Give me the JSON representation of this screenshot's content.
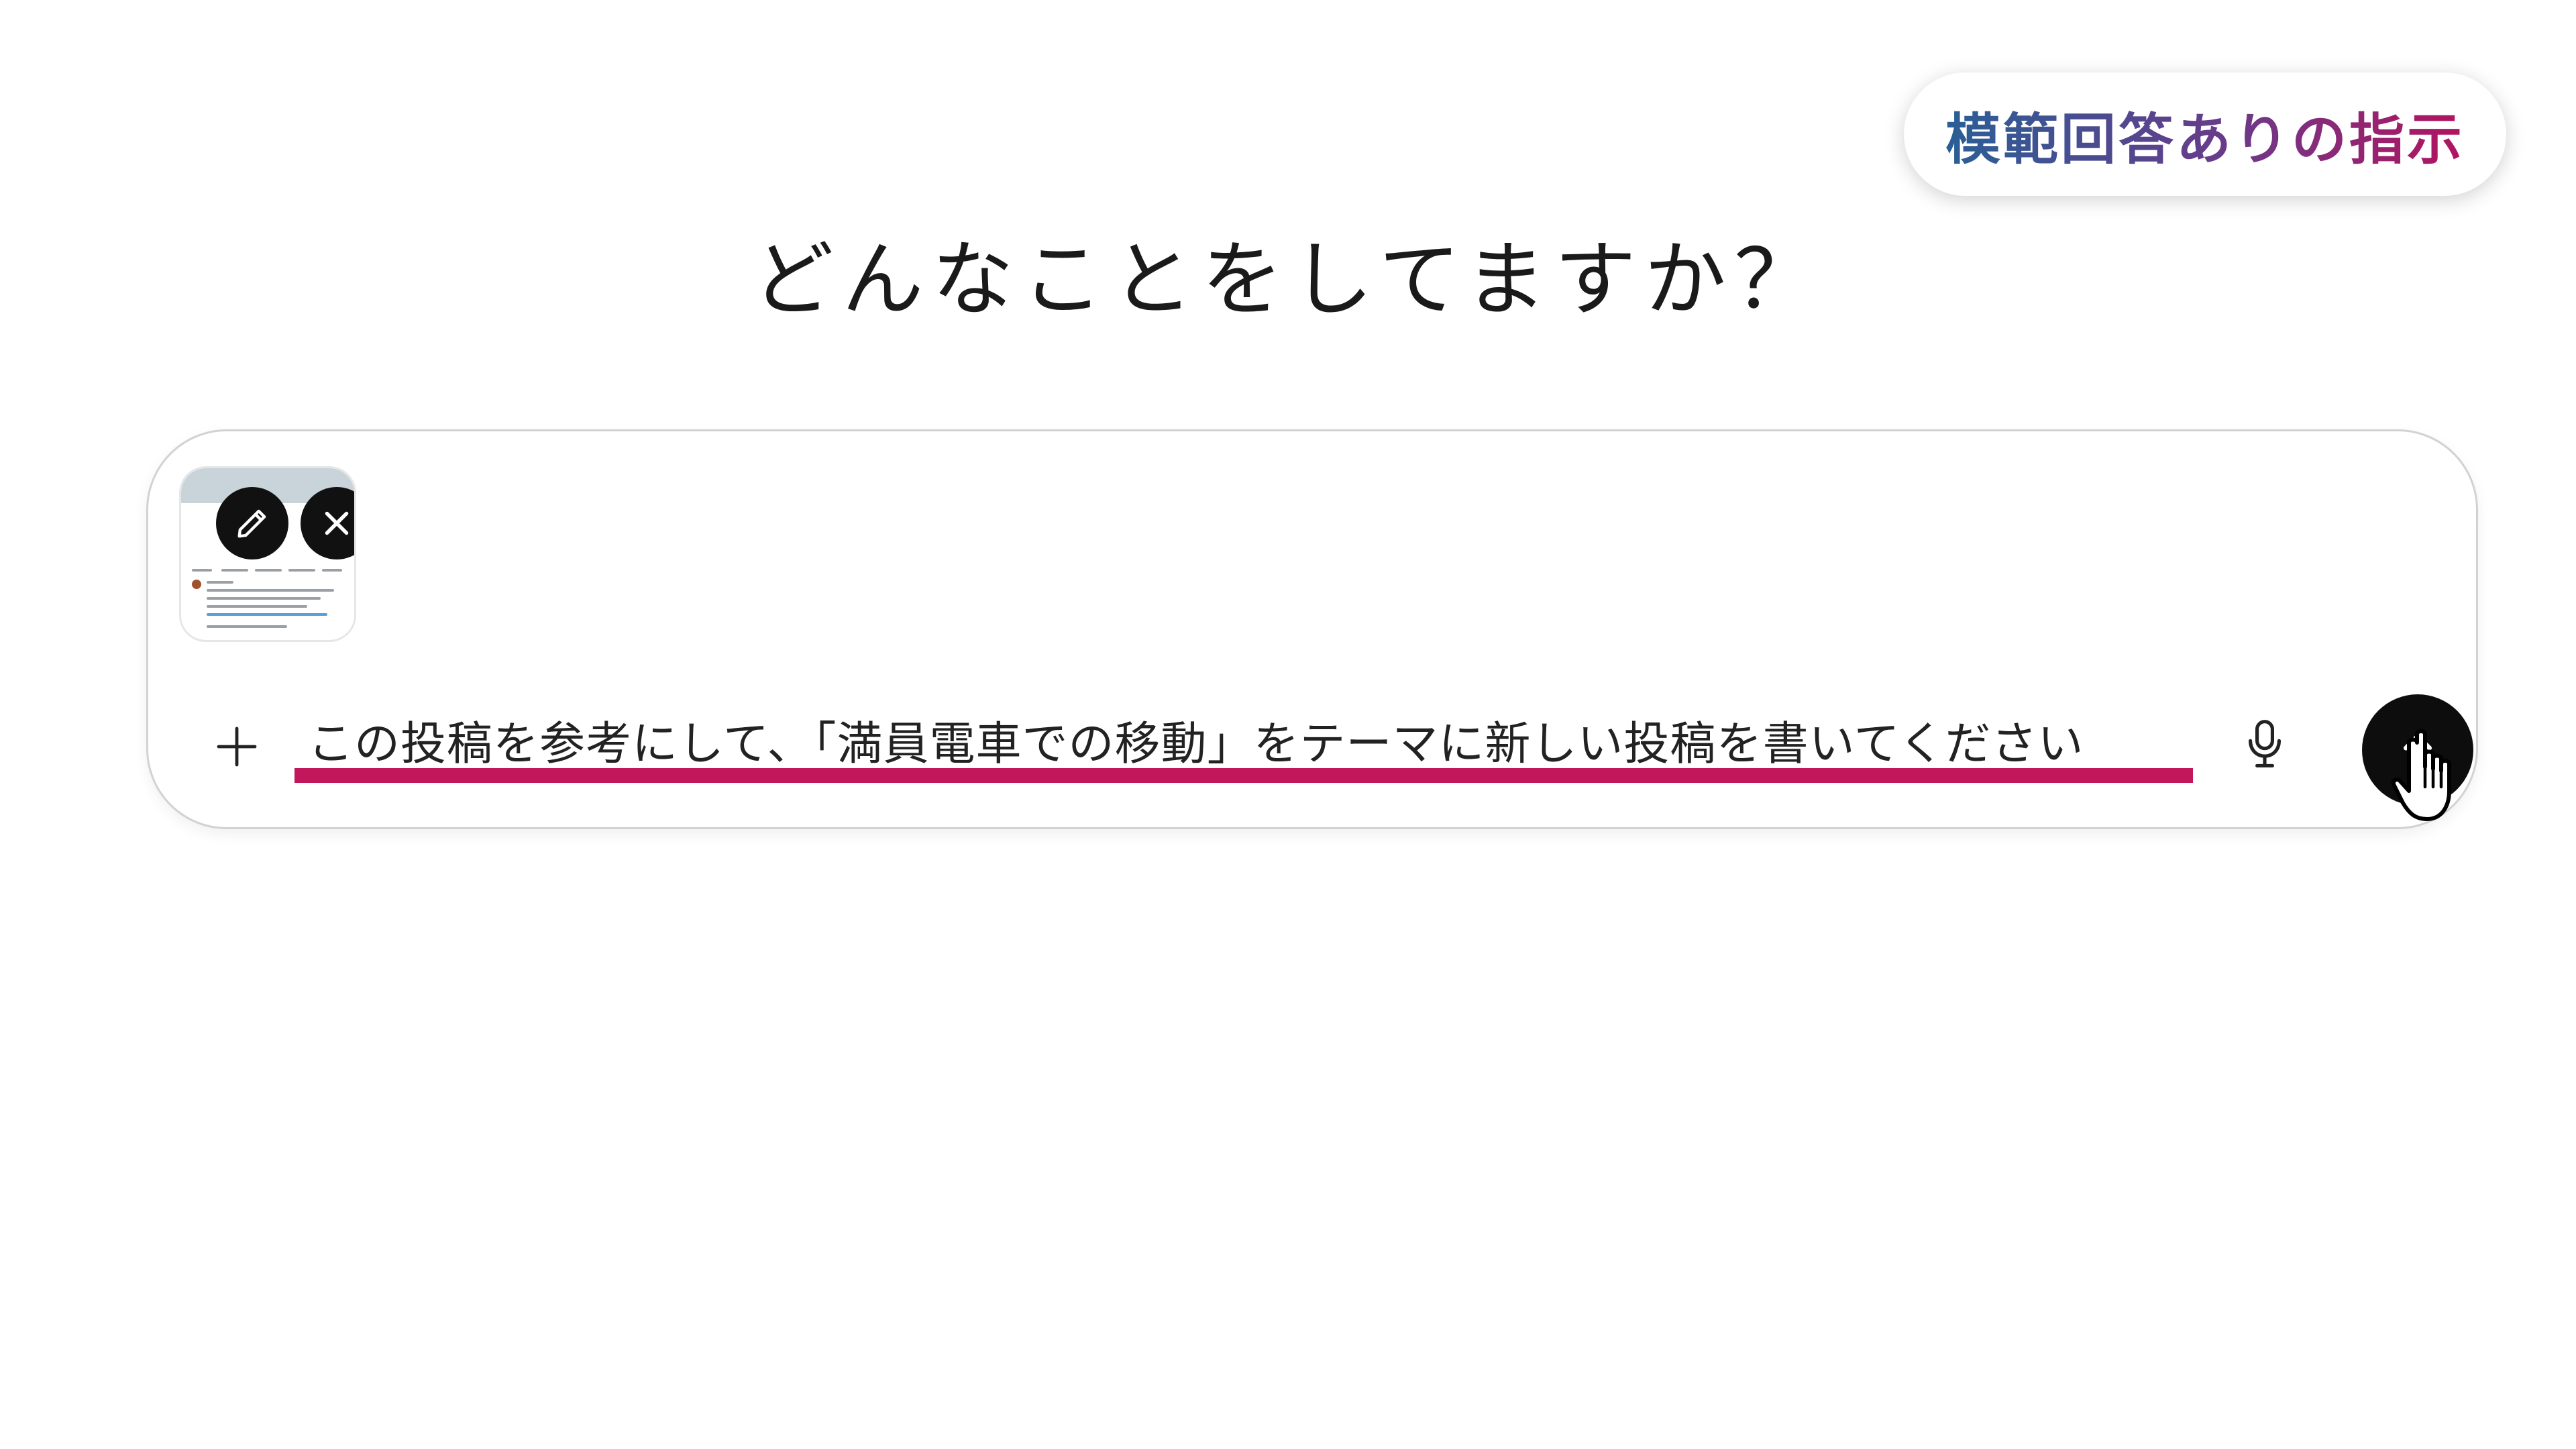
{
  "badge": {
    "label": "模範回答ありの指示"
  },
  "headline": "どんなことをしてますか？",
  "composer": {
    "prompt": "この投稿を参考にして、「満員電車での移動」をテーマに新しい投稿を書いてください",
    "attachment": {
      "edit_icon": "pencil-icon",
      "remove_icon": "close-icon"
    },
    "add_icon": "plus-icon",
    "mic_icon": "microphone-icon",
    "send_icon": "arrow-up-icon"
  },
  "colors": {
    "underline": "#c2185b",
    "badge_gradient_start": "#2a5f96",
    "badge_gradient_end": "#b3135f",
    "button_bg": "#111111"
  }
}
